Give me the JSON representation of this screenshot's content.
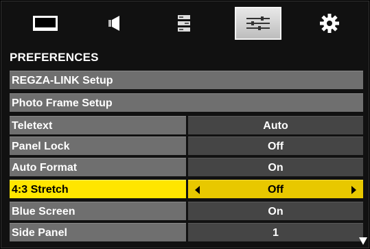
{
  "tabs": [
    {
      "icon": "picture-icon",
      "selected": false
    },
    {
      "icon": "sound-icon",
      "selected": false
    },
    {
      "icon": "options-list-icon",
      "selected": false
    },
    {
      "icon": "preferences-sliders-icon",
      "selected": true
    },
    {
      "icon": "setup-gear-icon",
      "selected": false
    }
  ],
  "menu": {
    "heading": "PREFERENCES",
    "items": [
      {
        "label": "REGZA-LINK Setup"
      },
      {
        "label": "Photo Frame Setup"
      },
      {
        "label": "Teletext",
        "value": "Auto"
      },
      {
        "label": "Panel Lock",
        "value": "Off"
      },
      {
        "label": "Auto Format",
        "value": "On"
      },
      {
        "label": "4:3 Stretch",
        "value": "Off",
        "highlighted": true
      },
      {
        "label": "Blue Screen",
        "value": "On"
      },
      {
        "label": "Side Panel",
        "value": "1"
      }
    ]
  },
  "colors": {
    "highlight": "#ffe600",
    "row_label_bg": "#6f6f6f",
    "row_value_bg": "#454545"
  },
  "scroll_indicator": "scroll-down-arrow-icon"
}
